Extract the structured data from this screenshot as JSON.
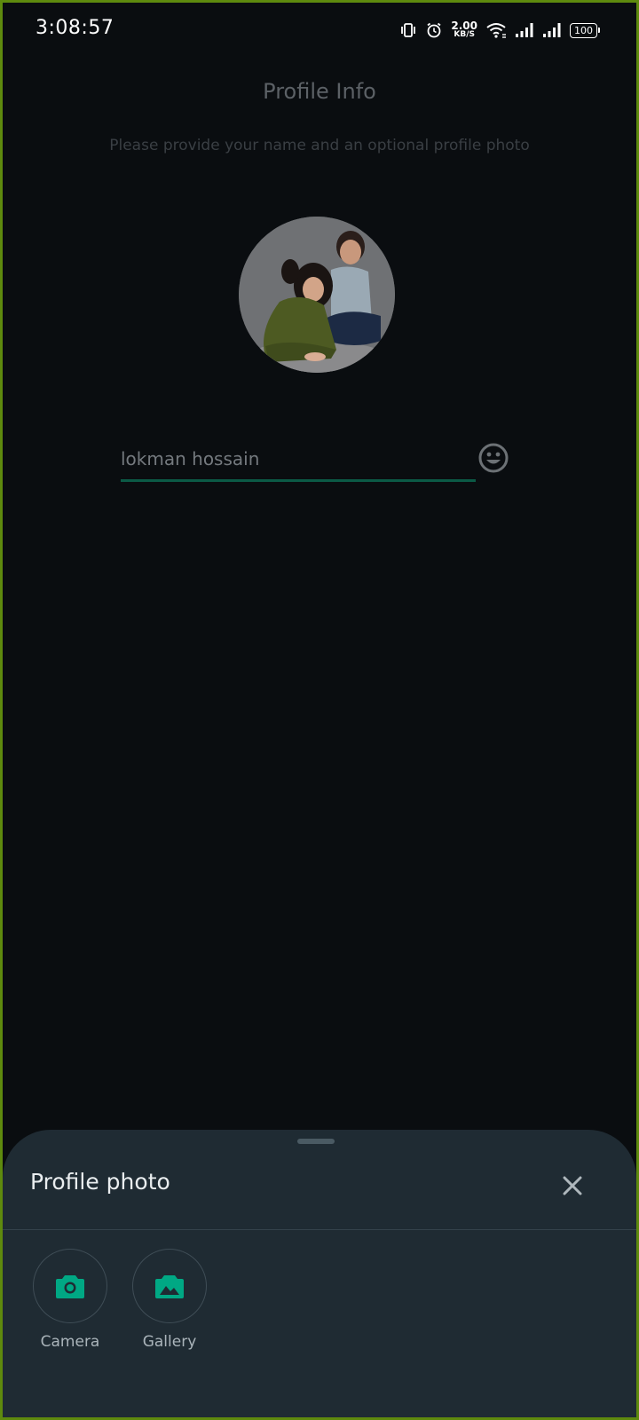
{
  "status_bar": {
    "time": "3:08:57",
    "net_speed_value": "2.00",
    "net_speed_unit": "KB/S",
    "battery": "100",
    "icons": [
      "vibrate-icon",
      "alarm-icon",
      "wifi-icon",
      "signal-icon",
      "signal-icon",
      "battery-icon"
    ]
  },
  "profile": {
    "title": "Profile Info",
    "subtitle": "Please provide your name and an optional profile photo",
    "name_value": "lokman hossain",
    "accent_color": "#0b5a46"
  },
  "sheet": {
    "title": "Profile photo",
    "options": [
      {
        "label": "Camera",
        "icon": "camera-icon"
      },
      {
        "label": "Gallery",
        "icon": "gallery-icon"
      }
    ],
    "icon_color": "#00a884",
    "background_color": "#1f2b33"
  }
}
